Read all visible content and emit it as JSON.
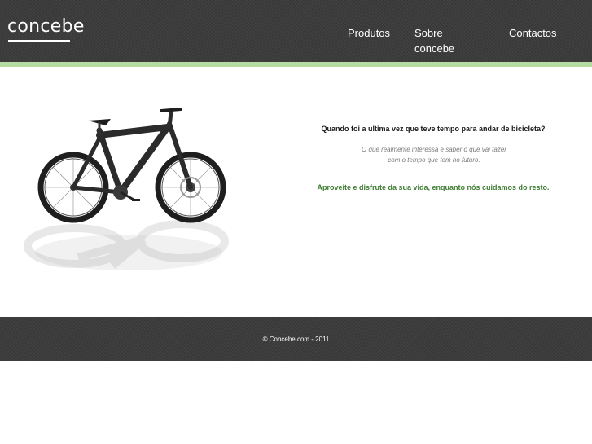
{
  "header": {
    "logo": "concebe",
    "nav": [
      {
        "label": "Produtos"
      },
      {
        "label": "Sobre concebe"
      },
      {
        "label": "Contactos"
      }
    ]
  },
  "main": {
    "question": "Quando foi a ultima vez que teve tempo para andar de bicicleta?",
    "subtext": "O que realmente interessa é saber o que vai fazer com o tempo que tem no futuro.",
    "tagline": "Aproveite e disfrute da sua vida, enquanto nós cuidamos do resto."
  },
  "footer": {
    "copyright": "© Concebe.com - 2011"
  },
  "colors": {
    "header_bg": "#3c3c3c",
    "accent_bar": "#b7dca2",
    "tagline": "#3f7d33",
    "subtext": "#7a7a7a"
  },
  "icons": {
    "hero_image": "mountain-bike-image"
  }
}
